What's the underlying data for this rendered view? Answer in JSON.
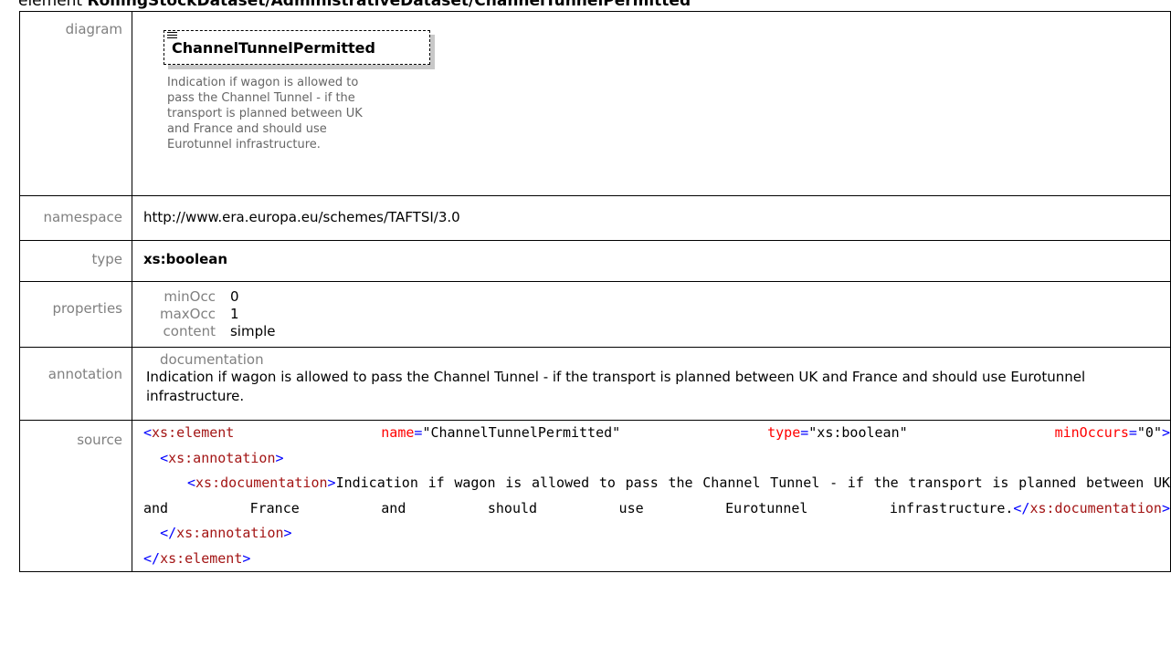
{
  "header": {
    "prefix": "element",
    "path": "RollingStockDataset/AdministrativeDataset/ChannelTunnelPermitted"
  },
  "rows": {
    "diagram_label": "diagram",
    "namespace_label": "namespace",
    "type_label": "type",
    "properties_label": "properties",
    "annotation_label": "annotation",
    "source_label": "source"
  },
  "diagram": {
    "element_name": "ChannelTunnelPermitted",
    "doc_lines": [
      "Indication if wagon is allowed to",
      "pass the Channel Tunnel - if the",
      "transport is planned between UK",
      "and France and should use",
      "Eurotunnel infrastructure."
    ]
  },
  "namespace": "http://www.era.europa.eu/schemes/TAFTSI/3.0",
  "type": "xs:boolean",
  "properties": [
    {
      "key": "minOcc",
      "value": "0"
    },
    {
      "key": "maxOcc",
      "value": "1"
    },
    {
      "key": "content",
      "value": "simple"
    }
  ],
  "annotation": {
    "heading": "documentation",
    "text": "Indication if wagon is allowed to pass the Channel Tunnel - if the transport is planned between UK and France and should use Eurotunnel infrastructure."
  },
  "source": {
    "el_open": "xs:element",
    "attr1_name": "name",
    "attr1_value": "\"ChannelTunnelPermitted\"",
    "attr2_name": "type",
    "attr2_value": "\"xs:boolean\"",
    "attr3_name": "minOccurs",
    "attr3_value": "\"0\"",
    "annotation_tag": "xs:annotation",
    "documentation_tag": "xs:documentation",
    "doc_text": "Indication if wagon is allowed to pass the Channel Tunnel - if the transport is planned between UK and France and should use Eurotunnel infrastructure."
  },
  "colors": {
    "tag": "#a31515",
    "bracket": "#0000ff",
    "attribute": "#ff0000",
    "label": "#808080"
  }
}
